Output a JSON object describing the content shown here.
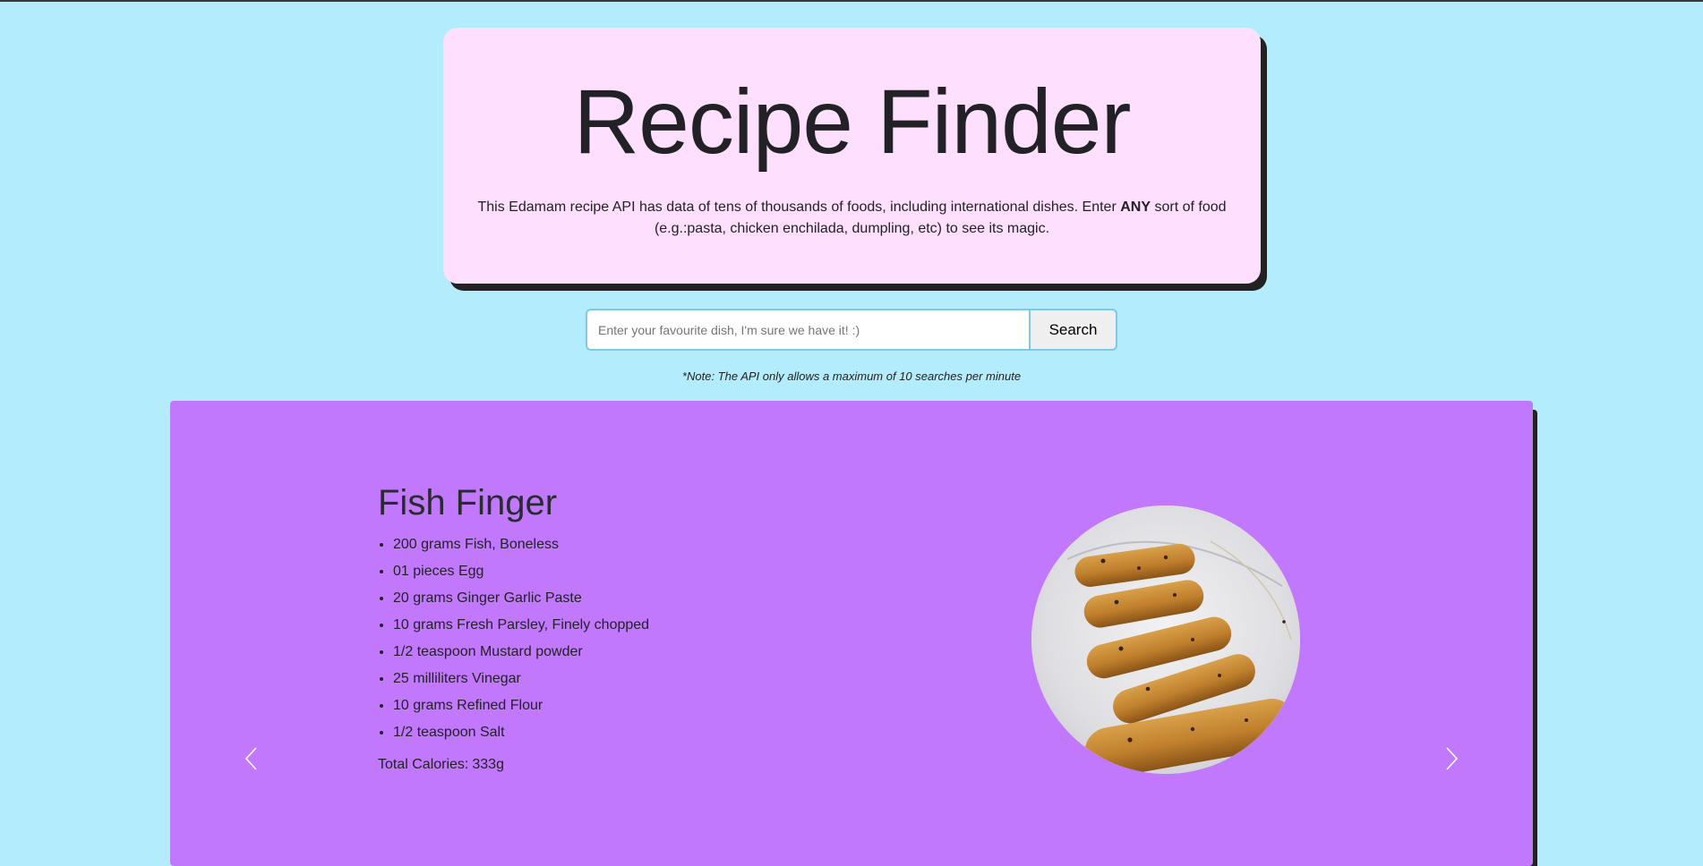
{
  "header": {
    "title": "Recipe Finder",
    "description_before": "This Edamam recipe API has data of tens of thousands of foods, including international dishes. Enter ",
    "description_bold": "ANY",
    "description_after": " sort of food (e.g.:pasta, chicken enchilada, dumpling, etc) to see its magic."
  },
  "search": {
    "placeholder": "Enter your favourite dish, I'm sure we have it! :)",
    "value": "",
    "button_label": "Search",
    "note": "*Note: The API only allows a maximum of 10 searches per minute"
  },
  "recipe": {
    "title": "Fish Finger",
    "ingredients": [
      "200 grams Fish, Boneless",
      "01 pieces Egg",
      "20 grams Ginger Garlic Paste",
      "10 grams Fresh Parsley, Finely chopped",
      "1/2 teaspoon Mustard powder",
      "25 milliliters Vinegar",
      "10 grams Refined Flour",
      "1/2 teaspoon Salt"
    ],
    "calories_label": "Total Calories:",
    "calories_value": "333g"
  },
  "icons": {
    "prev": "chevron-left-icon",
    "next": "chevron-right-icon"
  },
  "colors": {
    "background": "#b3ecfc",
    "header_card": "#ffdffe",
    "recipe_card": "#c278fc",
    "shadow": "#222222"
  }
}
